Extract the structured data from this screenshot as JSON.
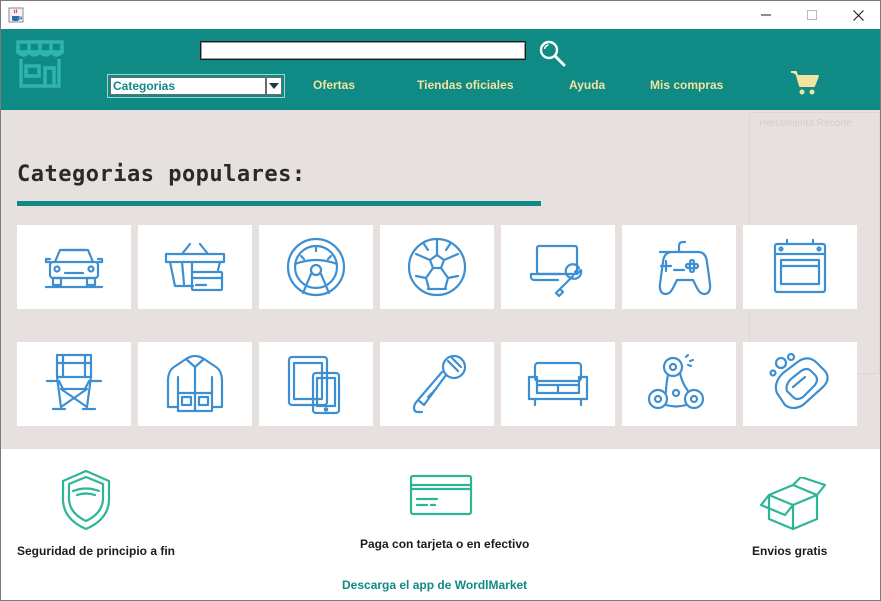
{
  "window": {
    "icons": {
      "app": "java-cup-icon",
      "minimize": "minimize-icon",
      "maximize": "maximize-icon",
      "close": "close-icon"
    }
  },
  "header": {
    "logo_icon": "storefront-icon",
    "search": {
      "value": "",
      "placeholder": "",
      "icon": "search-icon"
    },
    "category_select": {
      "selected": "Categorias",
      "icon": "chevron-down-icon"
    },
    "nav": [
      {
        "label": "Ofertas"
      },
      {
        "label": "Tiendas oficiales"
      },
      {
        "label": "Ayuda"
      },
      {
        "label": "Mis compras"
      }
    ],
    "cart_icon": "shopping-cart-icon"
  },
  "main": {
    "title": "Categorias populares:",
    "background_ghost_text": "Herramienta Recorte",
    "categories_row1": [
      {
        "icon": "car-icon"
      },
      {
        "icon": "shopping-basket-card-icon"
      },
      {
        "icon": "steering-wheel-icon"
      },
      {
        "icon": "soccer-ball-icon"
      },
      {
        "icon": "laptop-wrench-icon"
      },
      {
        "icon": "gamepad-icon"
      },
      {
        "icon": "oven-icon"
      }
    ],
    "categories_row2": [
      {
        "icon": "camping-chair-icon"
      },
      {
        "icon": "jacket-icon"
      },
      {
        "icon": "tablet-phone-icon"
      },
      {
        "icon": "microphone-icon"
      },
      {
        "icon": "sofa-icon"
      },
      {
        "icon": "fidget-spinner-icon"
      },
      {
        "icon": "soap-icon"
      }
    ]
  },
  "footer": {
    "features": [
      {
        "label": "Seguridad de principio a fin",
        "icon": "shield-icon"
      },
      {
        "label": "Paga con tarjeta o en efectivo",
        "icon": "credit-card-icon"
      },
      {
        "label": "Envios gratis",
        "icon": "open-box-icon"
      }
    ],
    "app_link": "Descarga el app de WordlMarket"
  },
  "colors": {
    "header_bg": "#0f8a84",
    "nav_text": "#f1e3a0",
    "main_bg": "#e6e0df",
    "category_icon": "#3d8fd1",
    "feature_icon": "#2db596",
    "cart": "#f1e3a0"
  }
}
